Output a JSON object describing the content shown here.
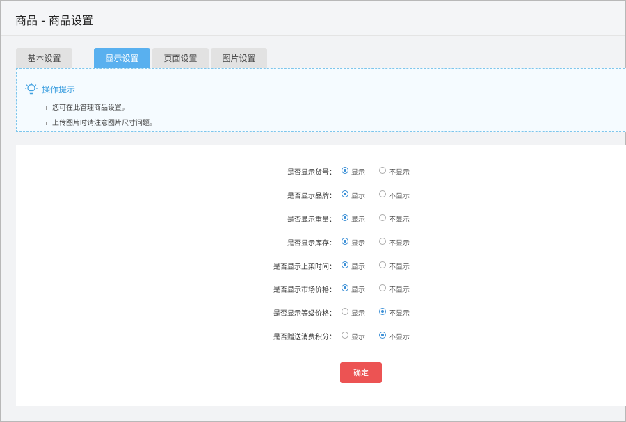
{
  "header": {
    "title": "商品 - 商品设置"
  },
  "tabs": [
    {
      "label": "基本设置",
      "active": false
    },
    {
      "label": "显示设置",
      "active": true
    },
    {
      "label": "页面设置",
      "active": false
    },
    {
      "label": "图片设置",
      "active": false
    }
  ],
  "tips": {
    "icon": "lightbulb-icon",
    "title": "操作提示",
    "items": [
      "您可在此管理商品设置。",
      "上传图片时请注意图片尺寸问题。"
    ]
  },
  "options": {
    "show": "显示",
    "hide": "不显示"
  },
  "settings": [
    {
      "label": "是否显示货号：",
      "value": "显示"
    },
    {
      "label": "是否显示品牌：",
      "value": "显示"
    },
    {
      "label": "是否显示重量：",
      "value": "显示"
    },
    {
      "label": "是否显示库存：",
      "value": "显示"
    },
    {
      "label": "是否显示上架时间：",
      "value": "显示"
    },
    {
      "label": "是否显示市场价格：",
      "value": "显示"
    },
    {
      "label": "是否显示等级价格：",
      "value": "不显示"
    },
    {
      "label": "是否赠送消费积分：",
      "value": "不显示"
    }
  ],
  "submit_label": "确定",
  "colors": {
    "accent": "#59b0ef",
    "submit": "#ec5353",
    "tips_border": "#7ec6ec",
    "radio_checked": "#3b8fd6"
  }
}
